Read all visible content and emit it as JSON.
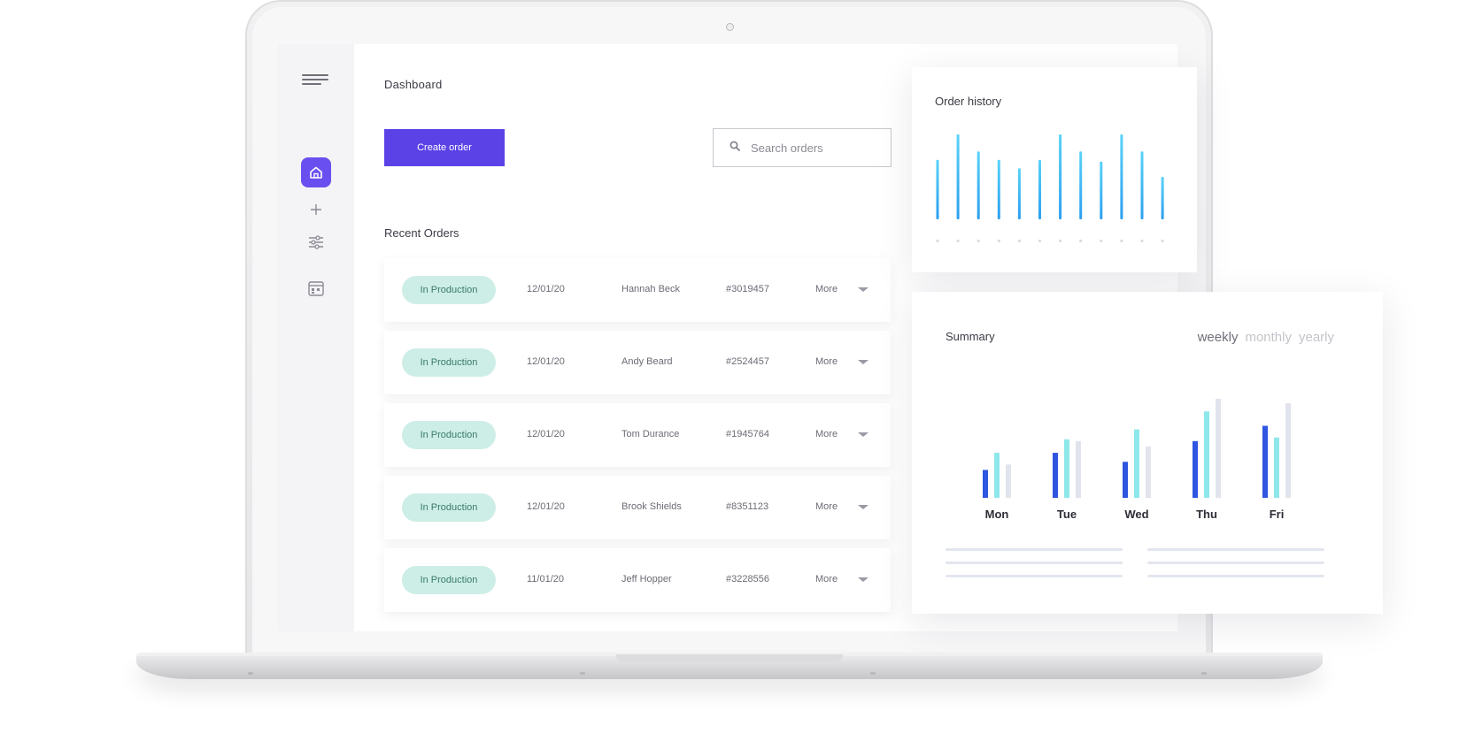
{
  "page": {
    "title": "Dashboard"
  },
  "actions": {
    "create_label": "Create order"
  },
  "search": {
    "placeholder": "Search orders"
  },
  "recent": {
    "title": "Recent Orders",
    "more_label": "More",
    "orders": [
      {
        "status": "In Production",
        "date": "12/01/20",
        "name": "Hannah Beck",
        "id": "#3019457"
      },
      {
        "status": "In Production",
        "date": "12/01/20",
        "name": "Andy Beard",
        "id": "#2524457"
      },
      {
        "status": "In Production",
        "date": "12/01/20",
        "name": "Tom Durance",
        "id": "#1945764"
      },
      {
        "status": "In Production",
        "date": "12/01/20",
        "name": "Brook Shields",
        "id": "#8351123"
      },
      {
        "status": "In Production",
        "date": "11/01/20",
        "name": "Jeff Hopper",
        "id": "#3228556"
      }
    ]
  },
  "sidebar": {
    "icons": [
      "menu-icon",
      "home-icon",
      "plus-icon",
      "sliders-icon",
      "calendar-icon"
    ],
    "accent": "#6a4ff0"
  },
  "order_history": {
    "title": "Order history"
  },
  "summary": {
    "title": "Summary",
    "tabs": [
      "weekly",
      "monthly",
      "yearly"
    ],
    "active_tab": "weekly"
  },
  "colors": {
    "primary": "#5b42e6",
    "badge_bg": "#cdeee6",
    "bar_blue": "#2f56e0",
    "bar_cyan": "#8ee7ea",
    "bar_grey": "#e1e4ec"
  },
  "chart_data": [
    {
      "type": "bar",
      "title": "Order history",
      "categories": [
        "",
        "",
        "",
        "",
        "",
        "",
        "",
        "",
        "",
        "",
        "",
        ""
      ],
      "values": [
        70,
        100,
        80,
        70,
        60,
        70,
        100,
        80,
        68,
        100,
        80,
        50
      ],
      "ylim": [
        0,
        100
      ],
      "grid": false
    },
    {
      "type": "bar",
      "title": "Summary",
      "categories": [
        "Mon",
        "Tue",
        "Wed",
        "Thu",
        "Fri"
      ],
      "series": [
        {
          "values": [
            31,
            50,
            40,
            63,
            80
          ]
        },
        {
          "values": [
            50,
            65,
            76,
            96,
            67
          ]
        },
        {
          "values": [
            37,
            63,
            57,
            110,
            105
          ]
        }
      ],
      "ylim": [
        0,
        110
      ],
      "grid": false
    }
  ]
}
